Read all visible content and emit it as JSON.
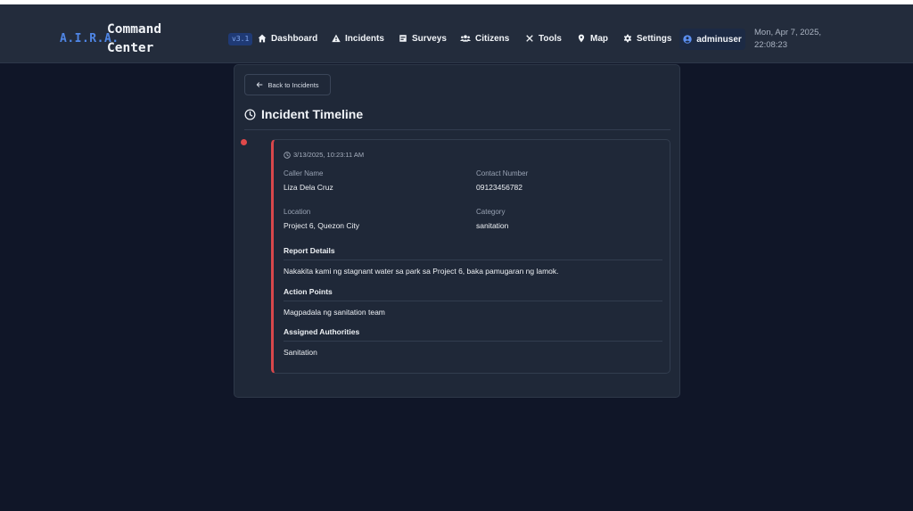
{
  "header": {
    "brand_short": "A.I.R.A.",
    "brand_name": "Command Center",
    "version": "v3.1",
    "nav": [
      {
        "label": "Dashboard",
        "icon": "home-icon"
      },
      {
        "label": "Incidents",
        "icon": "warning-icon"
      },
      {
        "label": "Surveys",
        "icon": "clipboard-icon"
      },
      {
        "label": "Citizens",
        "icon": "users-icon"
      },
      {
        "label": "Tools",
        "icon": "tools-icon"
      },
      {
        "label": "Map",
        "icon": "map-pin-icon"
      },
      {
        "label": "Settings",
        "icon": "gear-icon"
      }
    ],
    "user": {
      "name": "adminuser",
      "icon": "user-circle-icon"
    },
    "datetime_line1": "Mon, Apr 7, 2025,",
    "datetime_line2": "22:08:23"
  },
  "page": {
    "back_label": "Back to Incidents",
    "title": "Incident Timeline"
  },
  "event": {
    "timestamp": "3/13/2025, 10:23:11 AM",
    "caller_name_label": "Caller Name",
    "caller_name": "Liza Dela Cruz",
    "contact_label": "Contact Number",
    "contact": "09123456782",
    "location_label": "Location",
    "location": "Project 6, Quezon City",
    "category_label": "Category",
    "category": "sanitation",
    "report_heading": "Report Details",
    "report_text": "Nakakita kami ng stagnant water sa park sa Project 6, baka pamugaran ng lamok.",
    "action_heading": "Action Points",
    "action_text": "Magpadala ng sanitation team",
    "authorities_heading": "Assigned Authorities",
    "authorities_text": "Sanitation"
  },
  "colors": {
    "background": "#101628",
    "navbar": "#232c3c",
    "accent_blue": "#4f86e6",
    "status_red": "#d8474b"
  }
}
